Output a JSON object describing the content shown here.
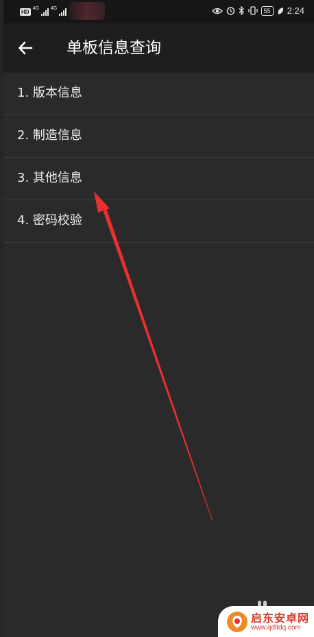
{
  "status_bar": {
    "hd_badge": "HD",
    "network_1": "4G",
    "network_2": "4G",
    "battery_level": "55",
    "time": "2:24"
  },
  "app_bar": {
    "title": "单板信息查询",
    "back_icon": "arrow-left-icon"
  },
  "menu": {
    "items": [
      {
        "label": "1. 版本信息"
      },
      {
        "label": "2. 制造信息"
      },
      {
        "label": "3. 其他信息"
      },
      {
        "label": "4. 密码校验"
      }
    ]
  },
  "annotation": {
    "color": "#e8302f"
  },
  "watermark": {
    "name": "启东安卓网",
    "url": "www.qdltdq.com"
  }
}
